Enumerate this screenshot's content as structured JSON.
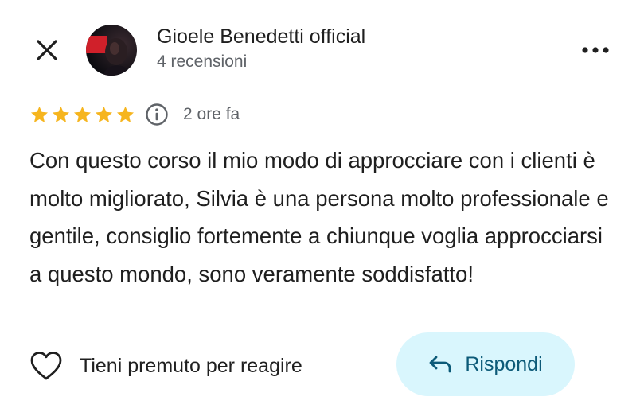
{
  "author": {
    "name": "Gioele Benedetti official",
    "reviews_count": "4 recensioni"
  },
  "review": {
    "rating": 5,
    "rating_max": 5,
    "time": "2 ore fa",
    "text": "Con questo corso il mio modo di approcciare con i clienti è molto migliorato, Silvia è una persona molto professionale e gentile, consiglio fortemente a chiunque voglia approcciarsi a questo mondo, sono veramente soddisfatto!"
  },
  "actions": {
    "react_label": "Tieni premuto per reagire",
    "reply_label": "Rispondi"
  },
  "icons": {
    "close": "close-icon",
    "more": "more-vert-icon",
    "info": "info-icon",
    "star": "star-icon",
    "heart": "heart-outline-icon",
    "reply": "reply-arrow-icon"
  },
  "colors": {
    "star": "#f6b51e",
    "reply_bg": "#d9f6fd",
    "reply_text": "#0c5a78",
    "secondary_text": "#5f6368",
    "primary_text": "#1f1f1f"
  }
}
